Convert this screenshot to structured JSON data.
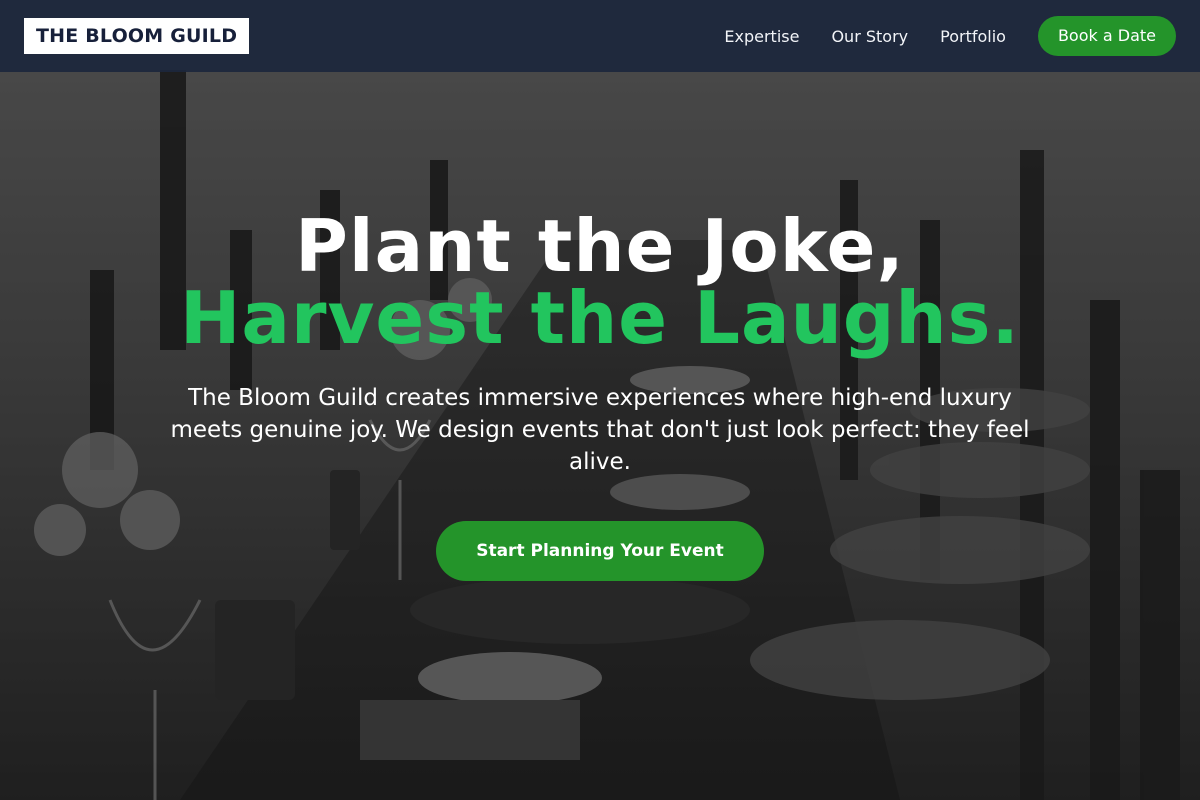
{
  "nav": {
    "logo_text": "THE BLOOM GUILD",
    "links": [
      "Expertise",
      "Our Story",
      "Portfolio"
    ],
    "cta_label": "Book a Date"
  },
  "hero": {
    "headline_line1": "Plant the Joke,",
    "headline_line2": "Harvest the Laughs.",
    "subtext": "The Bloom Guild creates immersive experiences where high-end luxury meets genuine joy. We design events that don't just look perfect: they feel alive.",
    "cta_label": "Start Planning Your Event",
    "background_image": "dining-table-photo"
  },
  "colors": {
    "accent_green": "#22c55e",
    "button_green": "#24942a",
    "navbar": "#1c273c",
    "logo_text": "#17203a"
  }
}
